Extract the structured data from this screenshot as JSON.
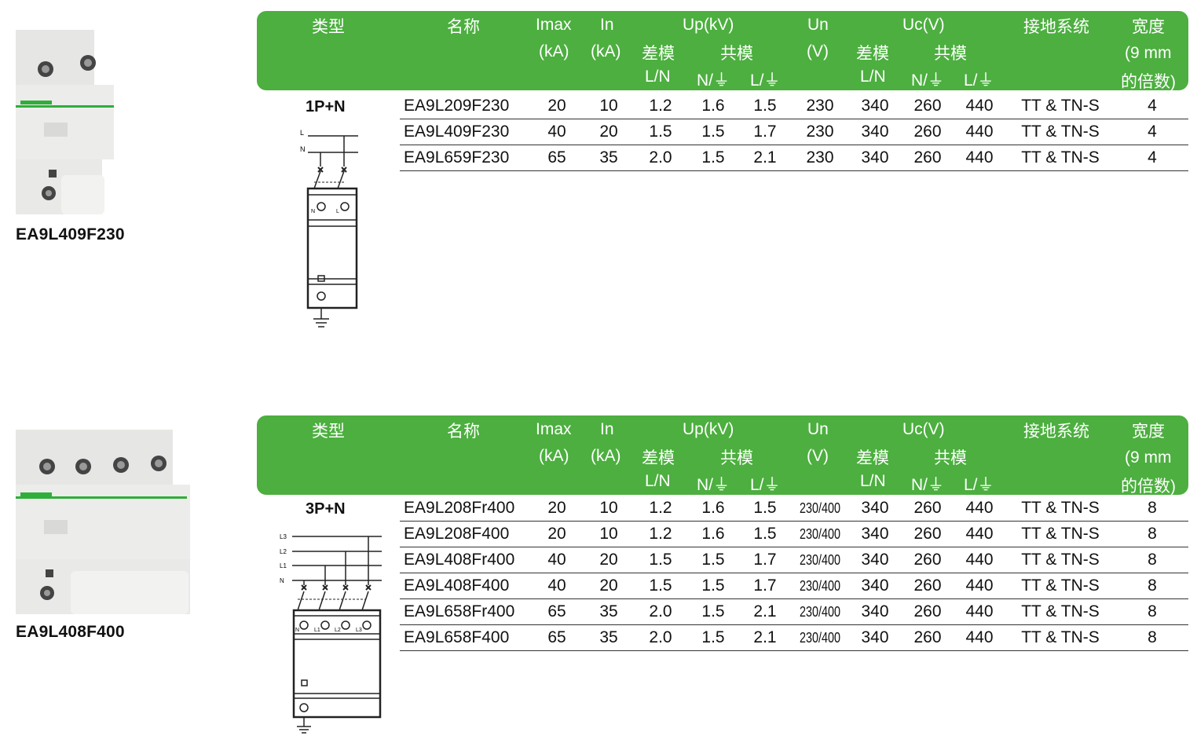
{
  "header": {
    "type": "类型",
    "name": "名称",
    "imax": "Imax",
    "imax_unit": "(kA)",
    "in": "In",
    "in_unit": "(kA)",
    "up": "Up(kV)",
    "diff_mode": "差模",
    "common_mode": "共模",
    "ln": "L/N",
    "n_earth": "N/⏚",
    "l_earth": "L/⏚",
    "un": "Un",
    "un_unit": "(V)",
    "uc": "Uc(V)",
    "earthing": "接地系统",
    "width": "宽度",
    "width_sub1": "(9 mm",
    "width_sub2": "的倍数)"
  },
  "section1": {
    "product": "EA9L409F230",
    "type": "1P+N",
    "wiring_labels": [
      "L",
      "N"
    ],
    "module_labels": [
      "N",
      "L"
    ],
    "rows": [
      {
        "name": "EA9L209F230",
        "imax": "20",
        "in": "10",
        "up_ln": "1.2",
        "up_ne": "1.6",
        "up_le": "1.5",
        "un": "230",
        "uc_ln": "340",
        "uc_ne": "260",
        "uc_le": "440",
        "earthing": "TT & TN-S",
        "width": "4"
      },
      {
        "name": "EA9L409F230",
        "imax": "40",
        "in": "20",
        "up_ln": "1.5",
        "up_ne": "1.5",
        "up_le": "1.7",
        "un": "230",
        "uc_ln": "340",
        "uc_ne": "260",
        "uc_le": "440",
        "earthing": "TT & TN-S",
        "width": "4"
      },
      {
        "name": "EA9L659F230",
        "imax": "65",
        "in": "35",
        "up_ln": "2.0",
        "up_ne": "1.5",
        "up_le": "2.1",
        "un": "230",
        "uc_ln": "340",
        "uc_ne": "260",
        "uc_le": "440",
        "earthing": "TT & TN-S",
        "width": "4"
      }
    ]
  },
  "section2": {
    "product": "EA9L408F400",
    "type": "3P+N",
    "wiring_labels": [
      "L3",
      "L2",
      "L1",
      "N"
    ],
    "module_labels": [
      "N",
      "L1",
      "L2",
      "L3"
    ],
    "rows": [
      {
        "name": "EA9L208Fr400",
        "imax": "20",
        "in": "10",
        "up_ln": "1.2",
        "up_ne": "1.6",
        "up_le": "1.5",
        "un": "230/400",
        "uc_ln": "340",
        "uc_ne": "260",
        "uc_le": "440",
        "earthing": "TT & TN-S",
        "width": "8"
      },
      {
        "name": "EA9L208F400",
        "imax": "20",
        "in": "10",
        "up_ln": "1.2",
        "up_ne": "1.6",
        "up_le": "1.5",
        "un": "230/400",
        "uc_ln": "340",
        "uc_ne": "260",
        "uc_le": "440",
        "earthing": "TT & TN-S",
        "width": "8"
      },
      {
        "name": "EA9L408Fr400",
        "imax": "40",
        "in": "20",
        "up_ln": "1.5",
        "up_ne": "1.5",
        "up_le": "1.7",
        "un": "230/400",
        "uc_ln": "340",
        "uc_ne": "260",
        "uc_le": "440",
        "earthing": "TT & TN-S",
        "width": "8"
      },
      {
        "name": "EA9L408F400",
        "imax": "40",
        "in": "20",
        "up_ln": "1.5",
        "up_ne": "1.5",
        "up_le": "1.7",
        "un": "230/400",
        "uc_ln": "340",
        "uc_ne": "260",
        "uc_le": "440",
        "earthing": "TT & TN-S",
        "width": "8"
      },
      {
        "name": "EA9L658Fr400",
        "imax": "65",
        "in": "35",
        "up_ln": "2.0",
        "up_ne": "1.5",
        "up_le": "2.1",
        "un": "230/400",
        "uc_ln": "340",
        "uc_ne": "260",
        "uc_le": "440",
        "earthing": "TT & TN-S",
        "width": "8"
      },
      {
        "name": "EA9L658F400",
        "imax": "65",
        "in": "35",
        "up_ln": "2.0",
        "up_ne": "1.5",
        "up_le": "2.1",
        "un": "230/400",
        "uc_ln": "340",
        "uc_ne": "260",
        "uc_le": "440",
        "earthing": "TT & TN-S",
        "width": "8"
      }
    ]
  },
  "brand_color": "#4caf3f"
}
